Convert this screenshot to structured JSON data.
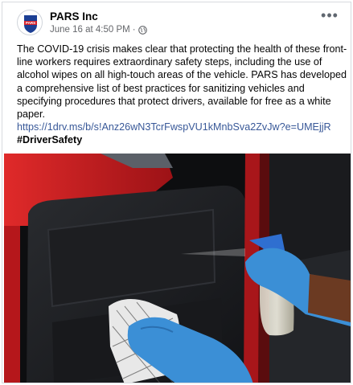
{
  "post": {
    "page_name": "PARS Inc",
    "logo_text": "PARS",
    "timestamp": "June 16 at 4:50 PM",
    "separator": "·",
    "audience_icon": "globe-icon",
    "more_icon": "more-options-icon",
    "more_label": "•••",
    "text": "The COVID-19 crisis makes clear that protecting the health of these front-line workers requires extraordinary safety steps, including the use of alcohol wipes on all high-touch areas of the vehicle. PARS has developed a comprehensive list of best practices for sanitizing vehicles and specifying procedures that protect drivers, available for free as a white paper.",
    "link": "https://1drv.ms/b/s!Anz26wN3TcrFwspVU1kMnbSva2ZvJw?e=UMEjjR",
    "hashtag": "#DriverSafety"
  },
  "colors": {
    "link": "#385898",
    "meta": "#65676b",
    "logo_blue": "#1c3f94",
    "logo_red": "#d4202a",
    "car_red": "#c41a1d",
    "glove_blue": "#3b8fd6"
  }
}
